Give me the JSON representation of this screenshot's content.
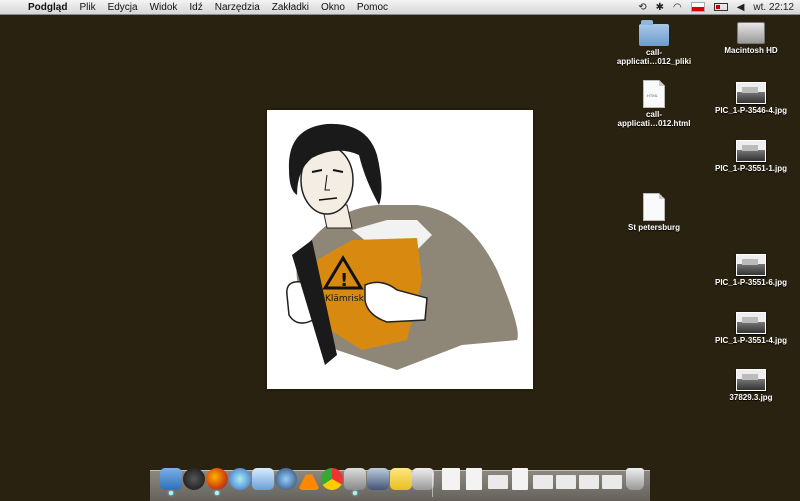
{
  "menubar": {
    "items": [
      "Podgląd",
      "Plik",
      "Edycja",
      "Widok",
      "Idź",
      "Narzędzia",
      "Zakładki",
      "Okno",
      "Pomoc"
    ],
    "clock": "wt. 22:12"
  },
  "image": {
    "badge_text": "Klämrisk"
  },
  "desktop_icons": [
    {
      "label": "call-\napplicati…012_pliki",
      "kind": "folder-icon"
    },
    {
      "label": "Macintosh HD",
      "kind": "hard-drive-icon"
    },
    {
      "label": "call-\napplicati…012.html",
      "kind": "html-file-icon"
    },
    {
      "label": "PIC_1-P-3546-4.jpg",
      "kind": "image-file-icon"
    },
    {
      "label": "PIC_1-P-3551-1.jpg",
      "kind": "image-file-icon"
    },
    {
      "label": "St petersburg",
      "kind": "document-icon"
    },
    {
      "label": "PIC_1-P-3551-6.jpg",
      "kind": "image-file-icon"
    },
    {
      "label": "PIC_1-P-3551-4.jpg",
      "kind": "image-file-icon"
    },
    {
      "label": "37829.3.jpg",
      "kind": "image-file-icon"
    }
  ],
  "dock": {
    "apps": [
      "finder-icon",
      "dashboard-icon",
      "firefox-icon",
      "app-store-icon",
      "mail-icon",
      "itunes-icon",
      "vlc-icon",
      "chrome-icon",
      "preview-icon",
      "script-editor-icon",
      "stickies-icon",
      "photo-icon"
    ],
    "docs": [
      "doc-stack-1-icon",
      "doc-stack-2-icon",
      "doc-stack-3-icon",
      "doc-stack-4-icon",
      "doc-stack-5-icon",
      "doc-stack-6-icon",
      "doc-stack-7-icon",
      "doc-stack-8-icon",
      "doc-stack-9-icon",
      "trash-icon"
    ]
  },
  "colors": {
    "desktop": "#2a2210",
    "shirt": "#d88a10"
  }
}
